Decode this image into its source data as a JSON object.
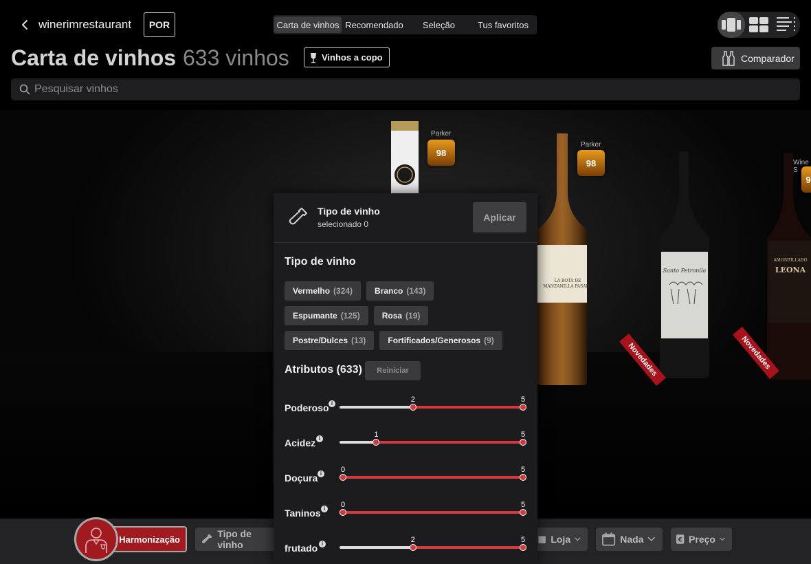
{
  "header": {
    "venue": "winerimrestaurant",
    "language": "POR",
    "tabs": [
      {
        "label": "Carta de vinhos",
        "active": true
      },
      {
        "label": "Recomendado",
        "active": false
      },
      {
        "label": "Seleção",
        "active": false
      },
      {
        "label": "Tus favoritos",
        "active": false
      }
    ],
    "view_modes": [
      "carousel-view-icon",
      "grid-view-icon",
      "list-view-icon"
    ],
    "title": "Carta de vinhos",
    "count": "633 vinhos",
    "glass_button": "Vinhos a copo",
    "comparator_button": "Comparador"
  },
  "search": {
    "placeholder": "Pesquisar vinhos"
  },
  "stage": {
    "scores": [
      {
        "label": "Parker",
        "value": "98"
      },
      {
        "label": "Parker",
        "value": "98"
      },
      {
        "label": "Wine S",
        "value": "9"
      }
    ],
    "ribbons": [
      "Novedades",
      "Novedades"
    ],
    "bottle_labels": [
      "LA BOTA DE MANZANILLA PASADA",
      "Santo Petronila",
      "AMONTILLADO LEONA"
    ]
  },
  "panel": {
    "title": "Tipo de vinho",
    "selected": "selecionado 0",
    "apply": "Aplicar",
    "section_title": "Tipo de vinho",
    "chip_rows": [
      [
        {
          "name": "Vermelho",
          "count": "(324)"
        },
        {
          "name": "Branco",
          "count": "(143)"
        }
      ],
      [
        {
          "name": "Espumante",
          "count": "(125)"
        },
        {
          "name": "Rosa",
          "count": "(19)"
        }
      ],
      [
        {
          "name": "Postre/Dulces",
          "count": "(13)"
        },
        {
          "name": "Fortificados/Generosos",
          "count": "(9)"
        }
      ]
    ],
    "attributes_title": "Atributos (633)",
    "reset": "Reiniciar",
    "sliders": [
      {
        "label": "Poderoso",
        "min": "2",
        "max": "5",
        "min_value": 2,
        "max_value": 5
      },
      {
        "label": "Acidez",
        "min": "1",
        "max": "5",
        "min_value": 1,
        "max_value": 5
      },
      {
        "label": "Doçura",
        "min": "0",
        "max": "5",
        "min_value": 0,
        "max_value": 5
      },
      {
        "label": "Taninos",
        "min": "0",
        "max": "5",
        "min_value": 0,
        "max_value": 5
      },
      {
        "label": "frutado",
        "min": "2",
        "max": "5",
        "min_value": 2,
        "max_value": 5
      }
    ]
  },
  "bottombar": {
    "harmonization": "Harmonização",
    "wine_type": "Tipo de vinho",
    "store": "Loja",
    "none": "Nada",
    "price": "Preço"
  },
  "colors": {
    "accent_red": "#d43a3c",
    "brand_red": "#a01a20",
    "score_gold": "#e79a1d"
  }
}
